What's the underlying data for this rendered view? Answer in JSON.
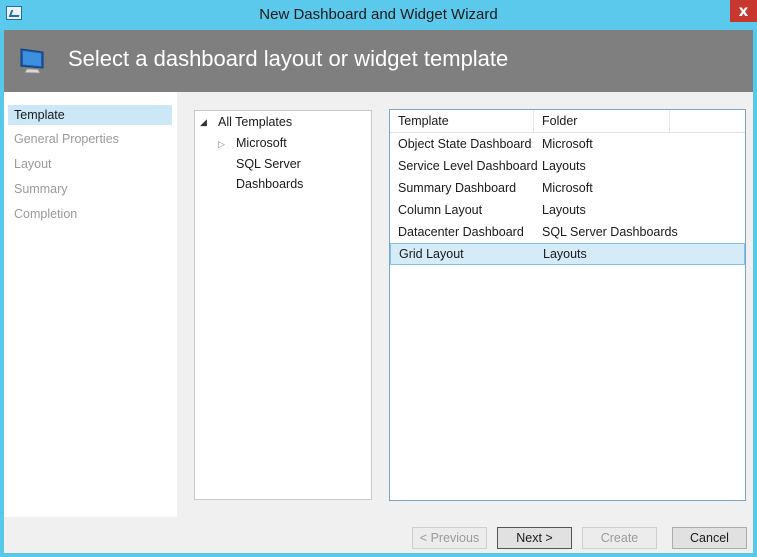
{
  "window": {
    "title": "New Dashboard and Widget Wizard",
    "close_glyph": "x",
    "app_icon": "wizard-window-icon"
  },
  "header": {
    "title": "Select a dashboard layout or widget template",
    "icon": "monitor-icon"
  },
  "nav": {
    "items": [
      {
        "label": "Template",
        "selected": true
      },
      {
        "label": "General Properties",
        "selected": false
      },
      {
        "label": "Layout",
        "selected": false
      },
      {
        "label": "Summary",
        "selected": false
      },
      {
        "label": "Completion",
        "selected": false
      }
    ]
  },
  "tree": {
    "root": {
      "label": "All Templates",
      "expanded": true
    },
    "children": [
      {
        "label": "Microsoft",
        "has_children": true
      },
      {
        "label": "SQL Server Dashboards",
        "has_children": false
      }
    ]
  },
  "grid": {
    "columns": [
      "Template",
      "Folder"
    ],
    "rows": [
      {
        "template": "Object State Dashboard",
        "folder": "Microsoft",
        "selected": false
      },
      {
        "template": "Service Level Dashboard",
        "folder": "Layouts",
        "selected": false
      },
      {
        "template": "Summary Dashboard",
        "folder": "Microsoft",
        "selected": false
      },
      {
        "template": "Column Layout",
        "folder": "Layouts",
        "selected": false
      },
      {
        "template": "Datacenter Dashboard",
        "folder": "SQL Server Dashboards",
        "selected": false
      },
      {
        "template": "Grid Layout",
        "folder": "Layouts",
        "selected": true
      }
    ]
  },
  "buttons": {
    "previous": "< Previous",
    "next": "Next >",
    "create": "Create",
    "cancel": "Cancel"
  },
  "colors": {
    "titlebar": "#5bc9ec",
    "header": "#7f7f7f",
    "selection": "#d5ebf8",
    "close": "#c7372f"
  }
}
